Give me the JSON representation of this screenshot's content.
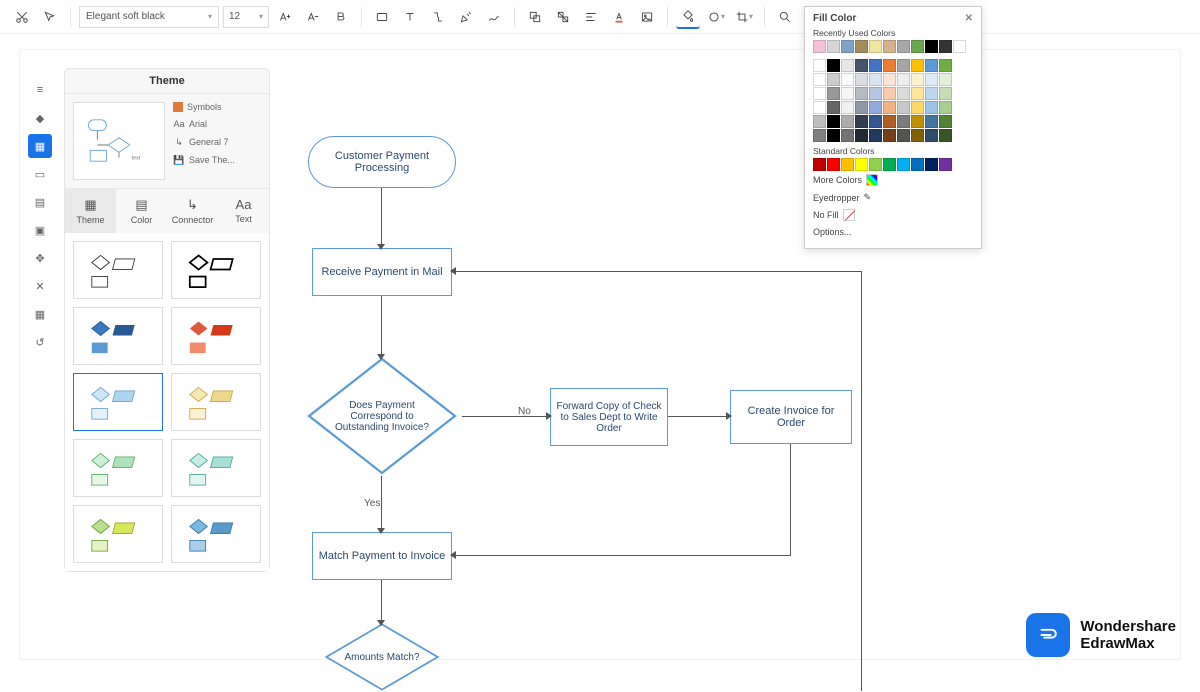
{
  "toolbar": {
    "font_name": "Elegant soft black",
    "font_size": "12"
  },
  "left_strip": [
    "list",
    "paint-bucket",
    "theme",
    "page",
    "layers",
    "image",
    "locate",
    "shuffle",
    "grid",
    "history"
  ],
  "theme_panel": {
    "title": "Theme",
    "attrs": {
      "symbols_label": "Symbols",
      "font_label": "Arial",
      "arrow_label": "General 7",
      "save_label": "Save The..."
    },
    "tabs": [
      "Theme",
      "Color",
      "Connector",
      "Text"
    ]
  },
  "flowchart": {
    "start": "Customer Payment Processing",
    "receive": "Receive Payment in Mail",
    "decision1": "Does Payment Correspond to Outstanding Invoice?",
    "yes_label": "Yes",
    "no_label": "No",
    "forward": "Forward Copy of Check to Sales Dept to Write Order",
    "create_invoice": "Create Invoice for Order",
    "match_payment": "Match Payment to Invoice",
    "decision2": "Amounts Match?"
  },
  "color_popup": {
    "title": "Fill Color",
    "recent_label": "Recently Used Colors",
    "recent_colors": [
      "#f4c2d7",
      "#d6d6d6",
      "#7fa3c7",
      "#a58b5b",
      "#f0e6a0",
      "#d4b18f",
      "#a8a8a8",
      "#6aa84f",
      "#000000",
      "#333333",
      "#ffffff"
    ],
    "theme_matrix_hues": [
      "#ffffff",
      "#000000",
      "#e7e6e6",
      "#44546a",
      "#4472c4",
      "#ed7d31",
      "#a5a5a5",
      "#ffc000",
      "#5b9bd5",
      "#70ad47"
    ],
    "standard_label": "Standard Colors",
    "standard_colors": [
      "#c00000",
      "#ff0000",
      "#ffc000",
      "#ffff00",
      "#92d050",
      "#00b050",
      "#00b0f0",
      "#0070c0",
      "#002060",
      "#7030a0"
    ],
    "more_colors": "More Colors",
    "eyedropper": "Eyedropper",
    "no_fill": "No Fill",
    "options": "Options..."
  },
  "brand": {
    "line1": "Wondershare",
    "line2": "EdrawMax"
  }
}
